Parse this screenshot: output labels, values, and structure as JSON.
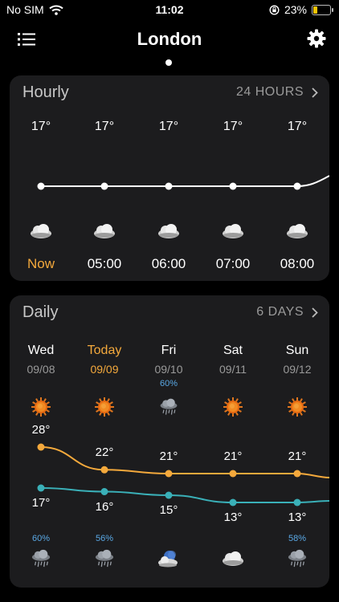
{
  "status": {
    "carrier": "No SIM",
    "time": "11:02",
    "battery": "23%",
    "battery_level": 0.23
  },
  "header": {
    "city": "London"
  },
  "hourly": {
    "title": "Hourly",
    "link": "24 HOURS",
    "items": [
      {
        "temp": "17°",
        "time": "Now",
        "icon": "cloud-icon"
      },
      {
        "temp": "17°",
        "time": "05:00",
        "icon": "cloud-icon"
      },
      {
        "temp": "17°",
        "time": "06:00",
        "icon": "cloud-icon"
      },
      {
        "temp": "17°",
        "time": "07:00",
        "icon": "cloud-icon"
      },
      {
        "temp": "17°",
        "time": "08:00",
        "icon": "cloud-icon"
      }
    ]
  },
  "daily": {
    "title": "Daily",
    "link": "6 DAYS",
    "items": [
      {
        "day": "Wed",
        "date": "09/08",
        "top_precip": "",
        "icon": "sun-icon",
        "max": "28°",
        "min": "17°",
        "max_value": 28,
        "min_value": 17,
        "bottom_precip": "60%",
        "bottom_icon": "rain-cloud-icon"
      },
      {
        "day": "Today",
        "date": "09/09",
        "top_precip": "",
        "icon": "sun-icon",
        "max": "22°",
        "min": "16°",
        "max_value": 22,
        "min_value": 16,
        "bottom_precip": "56%",
        "bottom_icon": "rain-cloud-icon"
      },
      {
        "day": "Fri",
        "date": "09/10",
        "top_precip": "60%",
        "icon": "rain-cloud-icon",
        "max": "21°",
        "min": "15°",
        "max_value": 21,
        "min_value": 15,
        "bottom_precip": "",
        "bottom_icon": "moon-cloud-icon"
      },
      {
        "day": "Sat",
        "date": "09/11",
        "top_precip": "",
        "icon": "sun-icon",
        "max": "21°",
        "min": "13°",
        "max_value": 21,
        "min_value": 13,
        "bottom_precip": "",
        "bottom_icon": "cloud-icon"
      },
      {
        "day": "Sun",
        "date": "09/12",
        "top_precip": "",
        "icon": "sun-icon",
        "max": "21°",
        "min": "13°",
        "max_value": 21,
        "min_value": 13,
        "bottom_precip": "58%",
        "bottom_icon": "rain-cloud-icon"
      }
    ]
  },
  "colors": {
    "accent": "#f4a93c",
    "max_line": "#f4a93c",
    "min_line": "#3ab0b8",
    "precip": "#5aa9e6",
    "card": "#1c1c1e"
  }
}
